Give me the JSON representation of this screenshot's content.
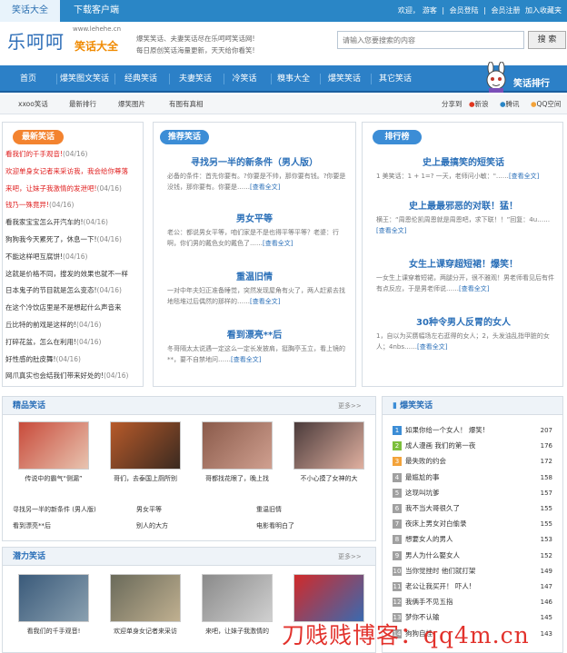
{
  "topbar": {
    "tab_active": "笑话大全",
    "tab_download": "下载客户端",
    "links": [
      "欢迎，",
      "游客",
      "|",
      "会员登陆",
      "|",
      "会员注册",
      "加入收藏夹"
    ]
  },
  "header": {
    "logo_main": "乐呵呵",
    "logo_site": "www.lehehe.cn",
    "logo_sub": "笑话大全",
    "slogan_1": "爆笑笑话、夫妻笑话尽在乐呵呵笑话网!",
    "slogan_2": "每日原创笑话海量更新，天天给你看笑!",
    "search_placeholder": "请输入您要搜索的内容",
    "search_button": "搜 索"
  },
  "nav": {
    "items": [
      "首页",
      "爆笑图文笑话",
      "经典笑话",
      "夫妻笑话",
      "冷笑话",
      "糗事大全",
      "爆笑笑话",
      "其它笑话"
    ],
    "rank_title": "笑话排行"
  },
  "subnav": {
    "items": [
      "xxoo笑话",
      "最新排行",
      "爆笑图片",
      "有图有真相"
    ],
    "share_label": "分享到",
    "share_items": [
      "新浪",
      "腾讯",
      "QQ空间"
    ]
  },
  "latest": {
    "title": "最新笑话",
    "items": [
      {
        "text": "看我们的千手观音!",
        "date": "(04/16)",
        "color": "#e02020"
      },
      {
        "text": "欢迎单身女记者来采访我，我会给你尊落",
        "date": "",
        "color": "#e02020"
      },
      {
        "text": "来吧，让妹子我激情的发泄吧!",
        "date": "(04/16)",
        "color": "#e02020"
      },
      {
        "text": "钱乃一殊竟异!",
        "date": "(04/16)",
        "color": "#e02020"
      },
      {
        "text": "看我家宝宝怎么开汽车的!",
        "date": "(04/16)",
        "color": "#333333"
      },
      {
        "text": "狗狗我今天累死了，休息一下!",
        "date": "(04/16)",
        "color": "#333333"
      },
      {
        "text": "不能这样吧互腐饼!",
        "date": "(04/16)",
        "color": "#333333"
      },
      {
        "text": "这就是价格不同，搜发的效果也就不一样",
        "date": "",
        "color": "#333333"
      },
      {
        "text": "日本鬼子的节目就是怎么变态!",
        "date": "(04/16)",
        "color": "#333333"
      },
      {
        "text": "在这个冷饮店里是不是想起什么声音来",
        "date": "",
        "color": "#333333"
      },
      {
        "text": "丘比特的前戏是这样的!",
        "date": "(04/16)",
        "color": "#333333"
      },
      {
        "text": "打碎花盆，怎么在利用!",
        "date": "(04/16)",
        "color": "#333333"
      },
      {
        "text": "好性感的肚皮舞!",
        "date": "(04/16)",
        "color": "#333333"
      },
      {
        "text": "网爪真实也会结我们带来好处的!",
        "date": "(04/16)",
        "color": "#333333"
      }
    ]
  },
  "recommend": {
    "title": "推荐笑话",
    "items": [
      {
        "heading": "寻找另一半的新条件（男人版）",
        "body": "必备的条件：首先你要有。?你要是不帅，那你要有钱。?你要是没钱，那你要有。你要是……",
        "more": "[查看全文]"
      },
      {
        "heading": "男女平等",
        "body": "老公：都说男女平等，咱们家是不是也得平等平等？老婆：行啊，你们男的戴色女的戴色了……",
        "more": "[查看全文]"
      },
      {
        "heading": "重温旧情",
        "body": "一对中年夫妇正准备睡觉，突然发现屋角有火了，两人赶紧去找地毯堆过后偶然的那样的……",
        "more": "[查看全文]"
      },
      {
        "heading": "看到漂亮**后",
        "body": "冬哥隔太太说遇一定这么一定长发披肩，挺胸亭玉立，看上镜的**，要不自禁地问……",
        "more": "[查看全文]"
      }
    ]
  },
  "ranking": {
    "title": "排行榜",
    "items": [
      {
        "heading": "史上最搞笑的短笑话",
        "body": "1 美笑话：1 + 1=? 一天，老师问小敏：\"……",
        "more": "[查看全文]"
      },
      {
        "heading": "史上最最邪恶的对联！猛！",
        "body": "横王：“周恩伦凯周恩就是周恩吧，求下联！！”回复：4u……",
        "more": "[查看全文]"
      },
      {
        "heading": "女生上课穿超短裙！爆笑！",
        "body": "一女生上课穿着短裙，两腿分开，很不雅观！男老师看见后有件有点反应，于是男老师说……",
        "more": "[查看全文]"
      },
      {
        "heading": "30种令男人反胃的女人",
        "body": "1，自以为买赝幅场左右逛得的女人；2，头发油乱指甲脏的女人；4nbs……",
        "more": "[查看全文]"
      }
    ]
  },
  "featured": {
    "title": "精品笑话",
    "more": "更多>>",
    "thumbs": [
      "传说中的霸气“侧漏”",
      "哥们，去泰国上厕所别",
      "哥都找花眼了，晚上找",
      "不小心摸了女神的大"
    ],
    "links": [
      "寻找另一半的新条件 (男人版)",
      "男女平等",
      "重温旧情",
      "看到漂亮**后",
      "别人的大方",
      "电影看明白了"
    ]
  },
  "potential": {
    "title": "潜力笑话",
    "more": "更多>>",
    "thumbs": [
      "看我们的千手观音!",
      "欢迎单身女记者来采访",
      "来吧，让妹子我激情的",
      ""
    ]
  },
  "hot": {
    "title": "爆笑笑话",
    "items": [
      {
        "title": "如果你给一个女人！ 爆笑!",
        "value": "207",
        "color": "#3c8dd6"
      },
      {
        "title": "成人漫画 我们的第一夜",
        "value": "176",
        "color": "#7cbf3c"
      },
      {
        "title": "最失败的约会",
        "value": "172",
        "color": "#f3a33a"
      },
      {
        "title": "最尴尬的事",
        "value": "158",
        "color": "#a0a0a0"
      },
      {
        "title": "这现叫坑爹",
        "value": "157",
        "color": "#a0a0a0"
      },
      {
        "title": "我不当大哥很久了",
        "value": "155",
        "color": "#a0a0a0"
      },
      {
        "title": "夜床上男女对白偷录",
        "value": "155",
        "color": "#a0a0a0"
      },
      {
        "title": "想要女人的男人",
        "value": "153",
        "color": "#a0a0a0"
      },
      {
        "title": "男人为什么娶女人",
        "value": "152",
        "color": "#a0a0a0"
      },
      {
        "title": "当你觉挫时 他们就打架",
        "value": "149",
        "color": "#a0a0a0"
      },
      {
        "title": "老公让我买开！ 吓人!",
        "value": "147",
        "color": "#a0a0a0"
      },
      {
        "title": "我俩手不见五指",
        "value": "146",
        "color": "#a0a0a0"
      },
      {
        "title": "梦你不认输",
        "value": "145",
        "color": "#a0a0a0"
      },
      {
        "title": "狗狗自挂",
        "value": "143",
        "color": "#a0a0a0"
      }
    ]
  },
  "watermark": "刀贱贱博客：qq4m.cn"
}
